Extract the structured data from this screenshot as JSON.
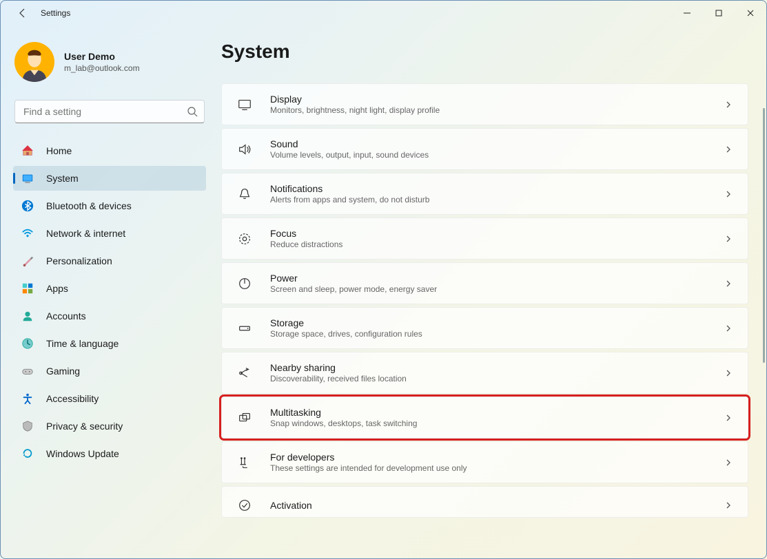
{
  "window": {
    "title": "Settings"
  },
  "profile": {
    "name": "User Demo",
    "email": "m_lab@outlook.com"
  },
  "search": {
    "placeholder": "Find a setting"
  },
  "nav": {
    "items": [
      {
        "label": "Home"
      },
      {
        "label": "System"
      },
      {
        "label": "Bluetooth & devices"
      },
      {
        "label": "Network & internet"
      },
      {
        "label": "Personalization"
      },
      {
        "label": "Apps"
      },
      {
        "label": "Accounts"
      },
      {
        "label": "Time & language"
      },
      {
        "label": "Gaming"
      },
      {
        "label": "Accessibility"
      },
      {
        "label": "Privacy & security"
      },
      {
        "label": "Windows Update"
      }
    ],
    "selected_index": 1
  },
  "page": {
    "title": "System"
  },
  "cards": [
    {
      "title": "Display",
      "subtitle": "Monitors, brightness, night light, display profile"
    },
    {
      "title": "Sound",
      "subtitle": "Volume levels, output, input, sound devices"
    },
    {
      "title": "Notifications",
      "subtitle": "Alerts from apps and system, do not disturb"
    },
    {
      "title": "Focus",
      "subtitle": "Reduce distractions"
    },
    {
      "title": "Power",
      "subtitle": "Screen and sleep, power mode, energy saver"
    },
    {
      "title": "Storage",
      "subtitle": "Storage space, drives, configuration rules"
    },
    {
      "title": "Nearby sharing",
      "subtitle": "Discoverability, received files location"
    },
    {
      "title": "Multitasking",
      "subtitle": "Snap windows, desktops, task switching"
    },
    {
      "title": "For developers",
      "subtitle": "These settings are intended for development use only"
    },
    {
      "title": "Activation",
      "subtitle": ""
    }
  ],
  "highlighted_card_index": 7
}
